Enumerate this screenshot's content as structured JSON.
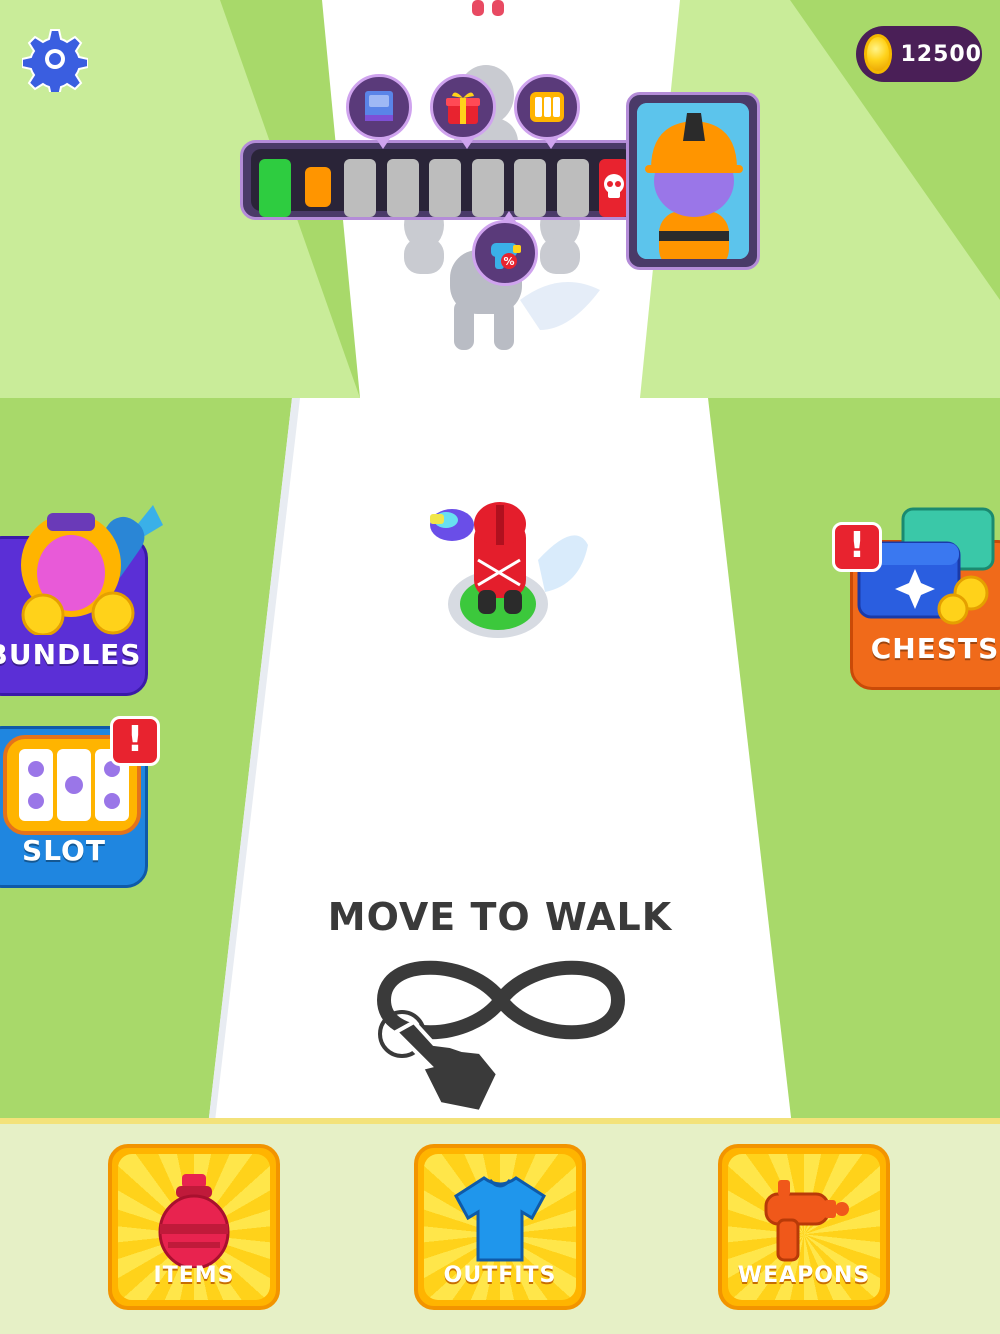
{
  "hud": {
    "coins": "12500",
    "settings_icon": "gear-icon"
  },
  "progress": {
    "segments": [
      {
        "state": "complete",
        "color": "#2ecc40"
      },
      {
        "state": "current",
        "color": "#ff9500"
      },
      {
        "state": "locked",
        "color": "#bdbdbd"
      },
      {
        "state": "locked",
        "color": "#bdbdbd"
      },
      {
        "state": "locked",
        "color": "#bdbdbd"
      },
      {
        "state": "locked",
        "color": "#bdbdbd"
      },
      {
        "state": "locked",
        "color": "#bdbdbd"
      },
      {
        "state": "locked",
        "color": "#bdbdbd"
      },
      {
        "state": "boss",
        "color": "#e8232f"
      }
    ],
    "rewards": [
      "book-icon",
      "gift-icon",
      "slot-icon",
      "weapon-discount-icon"
    ],
    "boss_icon": "skull-icon"
  },
  "side_buttons": {
    "bundles": "BUNDLES",
    "slot": "SLOT",
    "chests": "CHESTS",
    "alert_mark": "!"
  },
  "hint": {
    "text": "MOVE TO WALK",
    "icon": "infinity-swipe-icon"
  },
  "tabs": {
    "items": "ITEMS",
    "outfits": "OUTFITS",
    "weapons": "WEAPONS"
  },
  "colors": {
    "grass": "#a8d96a",
    "road": "#ffffff",
    "tab_yellow": "#ffb400",
    "bundles_purple": "#5b2fd6",
    "slot_blue": "#1f86e0",
    "chests_orange": "#f06a1a"
  }
}
